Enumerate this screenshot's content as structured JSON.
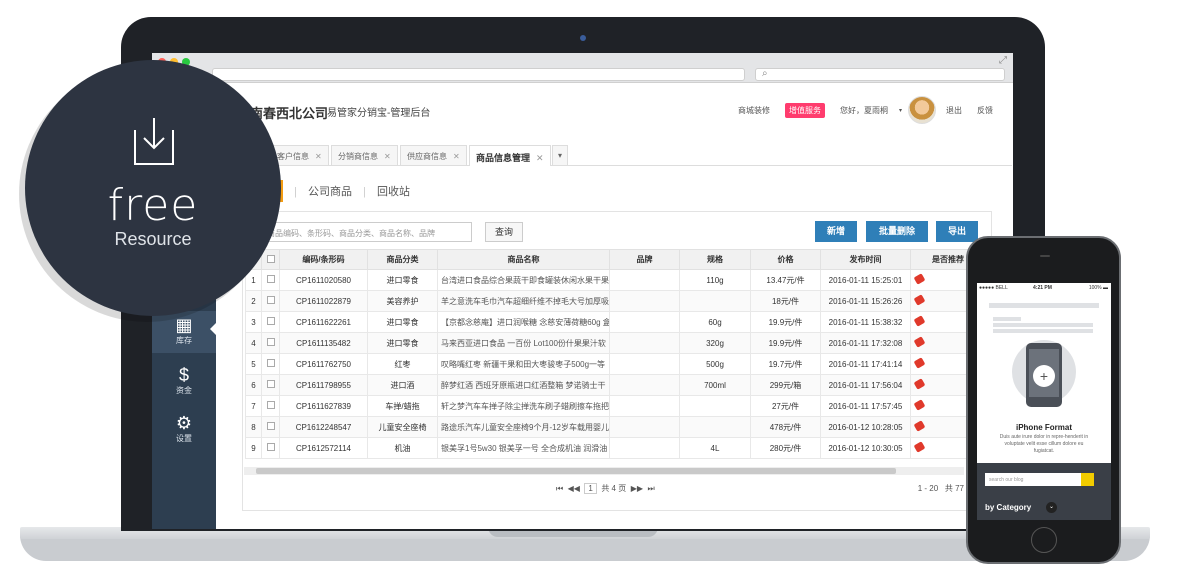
{
  "app": {
    "company": "西北公司",
    "company_prefix": "南春",
    "subtitle": "易管家分销宝-管理后台",
    "header_links": {
      "mall_decor": "商城装修",
      "vip_service": "增值服务",
      "greeting": "您好，夏雨桐",
      "logout": "退出",
      "feedback": "反馈"
    }
  },
  "tabs": [
    {
      "label": "客户信息"
    },
    {
      "label": "分销商信息"
    },
    {
      "label": "供应商信息"
    },
    {
      "label": "商品信息管理"
    }
  ],
  "tab_close": "✕",
  "subnav": {
    "active": "品",
    "company_goods": "公司商品",
    "recycle": "回收站",
    "sep": "|"
  },
  "sidebar": [
    {
      "label": "库存",
      "icon": "store-icon"
    },
    {
      "label": "资金",
      "icon": "money-icon"
    },
    {
      "label": "设置",
      "icon": "gear-icon"
    }
  ],
  "toolbar": {
    "search_placeholder": "商品编码、条形码、商品分类、商品名称、品牌",
    "query": "查询",
    "add": "新增",
    "batch_delete": "批量删除",
    "export": "导出"
  },
  "table": {
    "headers": [
      "",
      "",
      "编码/条形码",
      "商品分类",
      "商品名称",
      "品牌",
      "规格",
      "价格",
      "发布时间",
      "是否推荐"
    ],
    "rows": [
      {
        "no": "1",
        "code": "CP1611020580",
        "cat": "进口零食",
        "name": "台湾进口食品综合果蔬干即食罐装休闲水果干果",
        "brand": "",
        "spec": "110g",
        "price": "13.47元/件",
        "time": "2016-01-11 15:25:01"
      },
      {
        "no": "2",
        "code": "CP1611022879",
        "cat": "美容养护",
        "name": "羊之意洗车毛巾汽车超细纤维不掉毛大号加厚吸",
        "brand": "",
        "spec": "",
        "price": "18元/件",
        "time": "2016-01-11 15:26:26"
      },
      {
        "no": "3",
        "code": "CP1611622261",
        "cat": "进口零食",
        "name": "【京都念慈庵】进口润喉糖 念慈安薄荷糖60g 盒",
        "brand": "",
        "spec": "60g",
        "price": "19.9元/件",
        "time": "2016-01-11 15:38:32"
      },
      {
        "no": "4",
        "code": "CP1611135482",
        "cat": "进口零食",
        "name": "马来西亚进口食品 一百份 Lot100份什果果汁软",
        "brand": "",
        "spec": "320g",
        "price": "19.9元/件",
        "time": "2016-01-11 17:32:08"
      },
      {
        "no": "5",
        "code": "CP1611762750",
        "cat": "红枣",
        "name": "叹略嘴红枣 新疆干果和田大枣骏枣子500g一等",
        "brand": "",
        "spec": "500g",
        "price": "19.7元/件",
        "time": "2016-01-11 17:41:14"
      },
      {
        "no": "6",
        "code": "CP1611798955",
        "cat": "进口酒",
        "name": "醉梦红酒 西班牙原瓶进口红酒整箱 梦诺骑士干",
        "brand": "",
        "spec": "700ml",
        "price": "299元/箱",
        "time": "2016-01-11 17:56:04"
      },
      {
        "no": "7",
        "code": "CP1611627839",
        "cat": "车掸/蜡拖",
        "name": "轩之梦汽车车掸子除尘掸洗车刷子蜡刷擦车拖把车",
        "brand": "",
        "spec": "",
        "price": "27元/件",
        "time": "2016-01-11 17:57:45"
      },
      {
        "no": "8",
        "code": "CP1612248547",
        "cat": "儿童安全座椅",
        "name": "路途乐汽车儿童安全座椅9个月-12岁车载用婴儿",
        "brand": "",
        "spec": "",
        "price": "478元/件",
        "time": "2016-01-12 10:28:05"
      },
      {
        "no": "9",
        "code": "CP1612572114",
        "cat": "机油",
        "name": "银美孚1号5w30 银美孚一号 全合成机油 润滑油",
        "brand": "",
        "spec": "4L",
        "price": "280元/件",
        "time": "2016-01-12 10:30:05"
      }
    ]
  },
  "pager": {
    "first": "⏮",
    "prev": "◀◀",
    "page": "1",
    "total_pages": "共 4 页",
    "next": "▶▶",
    "last": "⏭",
    "range": "1 - 20",
    "total": "共 77"
  },
  "badge": {
    "free": "free",
    "resource": "Resource"
  },
  "phone": {
    "time": "4:21 PM",
    "carrier": "●●●●● BELL ",
    "battery": "100% ▬",
    "title": "iPhone Format",
    "text": "Duis aute irure dolor in repre-henderit in voluptate velit esse cillum dolore eu fugiatcat.",
    "search_placeholder": "search our blog",
    "category": "by Category"
  }
}
